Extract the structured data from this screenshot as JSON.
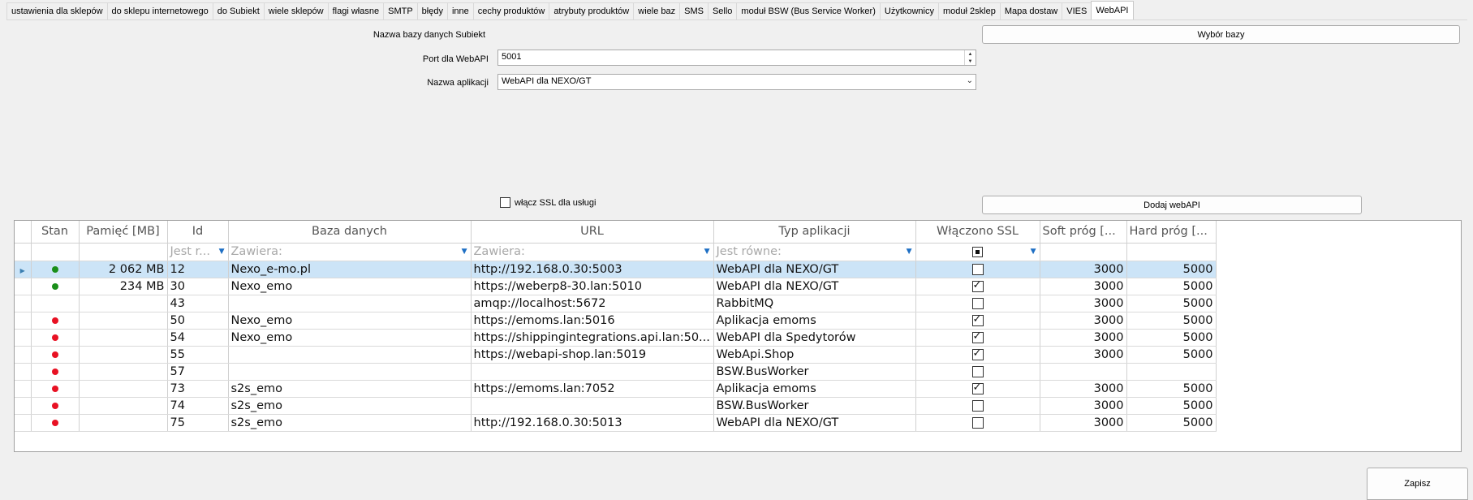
{
  "tabs": [
    {
      "label": "ustawienia dla sklepów",
      "active": false
    },
    {
      "label": "do sklepu internetowego",
      "active": false
    },
    {
      "label": "do Subiekt",
      "active": false
    },
    {
      "label": "wiele sklepów",
      "active": false
    },
    {
      "label": "flagi własne",
      "active": false
    },
    {
      "label": "SMTP",
      "active": false
    },
    {
      "label": "błędy",
      "active": false
    },
    {
      "label": "inne",
      "active": false
    },
    {
      "label": "cechy produktów",
      "active": false
    },
    {
      "label": "atrybuty produktów",
      "active": false
    },
    {
      "label": "wiele baz",
      "active": false
    },
    {
      "label": "SMS",
      "active": false
    },
    {
      "label": "Sello",
      "active": false
    },
    {
      "label": "moduł BSW (Bus Service Worker)",
      "active": false
    },
    {
      "label": "Użytkownicy",
      "active": false
    },
    {
      "label": "moduł 2sklep",
      "active": false
    },
    {
      "label": "Mapa dostaw",
      "active": false
    },
    {
      "label": "VIES",
      "active": false
    },
    {
      "label": "WebAPI",
      "active": true
    }
  ],
  "form": {
    "db_name_label": "Nazwa bazy danych Subiekt",
    "db_name_value": "",
    "choose_db_button": "Wybór bazy",
    "port_label": "Port dla WebAPI",
    "port_value": "5001",
    "app_name_label": "Nazwa aplikacji",
    "app_name_value": "WebAPI dla NEXO/GT",
    "ssl_label": "włącz SSL dla usługi",
    "ssl_checked": false,
    "add_button": "Dodaj webAPI"
  },
  "grid": {
    "columns": [
      "Stan",
      "Pamięć [MB]",
      "Id",
      "Baza danych",
      "URL",
      "Typ aplikacji",
      "Włączono SSL",
      "Soft próg [...",
      "Hard próg [..."
    ],
    "filters": {
      "id": "Jest r...",
      "baza": "Zawiera:",
      "url": "Zawiera:",
      "typ": "Jest równe:"
    },
    "status_colors": {
      "green": "#1a8f1a",
      "red": "#e81123"
    },
    "rows": [
      {
        "status": "green",
        "memory": "2 062 MB",
        "id": "12",
        "db": "Nexo_e-mo.pl",
        "url": "http://192.168.0.30:5003",
        "type": "WebAPI dla NEXO/GT",
        "ssl": false,
        "soft": "3000",
        "hard": "5000",
        "selected": true
      },
      {
        "status": "green",
        "memory": "234 MB",
        "id": "30",
        "db": "Nexo_emo",
        "url": "https://weberp8-30.lan:5010",
        "type": "WebAPI dla NEXO/GT",
        "ssl": true,
        "soft": "3000",
        "hard": "5000",
        "selected": false
      },
      {
        "status": "",
        "memory": "",
        "id": "43",
        "db": "",
        "url": "amqp://localhost:5672",
        "type": "RabbitMQ",
        "ssl": false,
        "soft": "3000",
        "hard": "5000",
        "selected": false
      },
      {
        "status": "red",
        "memory": "",
        "id": "50",
        "db": "Nexo_emo",
        "url": "https://emoms.lan:5016",
        "type": "Aplikacja emoms",
        "ssl": true,
        "soft": "3000",
        "hard": "5000",
        "selected": false
      },
      {
        "status": "red",
        "memory": "",
        "id": "54",
        "db": "Nexo_emo",
        "url": "https://shippingintegrations.api.lan:50...",
        "type": "WebAPI dla Spedytorów",
        "ssl": true,
        "soft": "3000",
        "hard": "5000",
        "selected": false
      },
      {
        "status": "red",
        "memory": "",
        "id": "55",
        "db": "",
        "url": "https://webapi-shop.lan:5019",
        "type": "WebApi.Shop",
        "ssl": true,
        "soft": "3000",
        "hard": "5000",
        "selected": false
      },
      {
        "status": "red",
        "memory": "",
        "id": "57",
        "db": "",
        "url": "",
        "type": "BSW.BusWorker",
        "ssl": false,
        "soft": "",
        "hard": "",
        "selected": false
      },
      {
        "status": "red",
        "memory": "",
        "id": "73",
        "db": "s2s_emo",
        "url": "https://emoms.lan:7052",
        "type": "Aplikacja emoms",
        "ssl": true,
        "soft": "3000",
        "hard": "5000",
        "selected": false
      },
      {
        "status": "red",
        "memory": "",
        "id": "74",
        "db": "s2s_emo",
        "url": "",
        "type": "BSW.BusWorker",
        "ssl": false,
        "soft": "3000",
        "hard": "5000",
        "selected": false
      },
      {
        "status": "red",
        "memory": "",
        "id": "75",
        "db": "s2s_emo",
        "url": "http://192.168.0.30:5013",
        "type": "WebAPI dla NEXO/GT",
        "ssl": false,
        "soft": "3000",
        "hard": "5000",
        "selected": false
      }
    ]
  },
  "save_button": "Zapisz"
}
